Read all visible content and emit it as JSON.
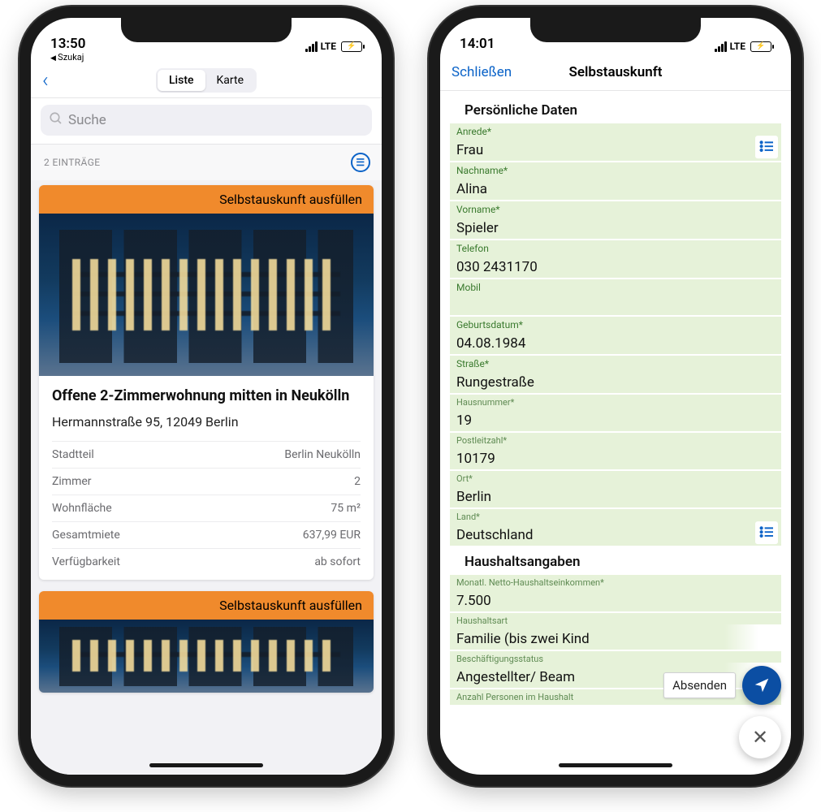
{
  "left": {
    "status": {
      "time": "13:50",
      "network": "LTE",
      "back_breadcrumb": "Szukaj"
    },
    "nav": {
      "tabs": {
        "list": "Liste",
        "map": "Karte",
        "active": "list"
      }
    },
    "search": {
      "placeholder": "Suche"
    },
    "count_label": "2 EINTRÄGE",
    "cards": [
      {
        "banner": "Selbstauskunft ausfüllen",
        "title": "Offene 2-Zimmerwohnung mitten in Neukölln",
        "address": "Hermannstraße 95, 12049 Berlin",
        "rows": [
          {
            "k": "Stadtteil",
            "v": "Berlin Neukölln"
          },
          {
            "k": "Zimmer",
            "v": "2"
          },
          {
            "k": "Wohnfläche",
            "v": "75 m²"
          },
          {
            "k": "Gesamtmiete",
            "v": "637,99  EUR"
          },
          {
            "k": "Verfügbarkeit",
            "v": "ab sofort"
          }
        ]
      },
      {
        "banner": "Selbstauskunft ausfüllen"
      }
    ]
  },
  "right": {
    "status": {
      "time": "14:01",
      "network": "LTE"
    },
    "nav": {
      "close": "Schließen",
      "title": "Selbstauskunft"
    },
    "sections": {
      "personal": {
        "heading": "Persönliche Daten",
        "fields": {
          "anrede": {
            "label": "Anrede*",
            "value": "Frau",
            "picker": true
          },
          "nachname": {
            "label": "Nachname*",
            "value": "Alina"
          },
          "vorname": {
            "label": "Vorname*",
            "value": "Spieler"
          },
          "telefon": {
            "label": "Telefon",
            "value": "030 2431170"
          },
          "mobil": {
            "label": "Mobil",
            "value": ""
          },
          "geburt": {
            "label": "Geburtsdatum*",
            "value": "04.08.1984"
          },
          "strasse": {
            "label": "Straße*",
            "value": "Rungestraße"
          },
          "hausnr": {
            "label": "Hausnummer*",
            "value": "19"
          },
          "plz": {
            "label": "Postleitzahl*",
            "value": "10179"
          },
          "ort": {
            "label": "Ort*",
            "value": "Berlin"
          },
          "land": {
            "label": "Land*",
            "value": "Deutschland",
            "picker": true
          }
        }
      },
      "household": {
        "heading": "Haushaltsangaben",
        "fields": {
          "einkommen": {
            "label": "Monatl. Netto-Haushaltseinkommen*",
            "value": "7.500"
          },
          "haushaltsart": {
            "label": "Haushaltsart",
            "value": "Familie (bis zwei Kind"
          },
          "beschaeft": {
            "label": "Beschäftigungsstatus",
            "value": "Angestellter/ Beam"
          },
          "personen": {
            "label": "Anzahl Personen im Haushalt",
            "value": ""
          }
        }
      }
    },
    "fab": {
      "send_label": "Absenden"
    }
  }
}
